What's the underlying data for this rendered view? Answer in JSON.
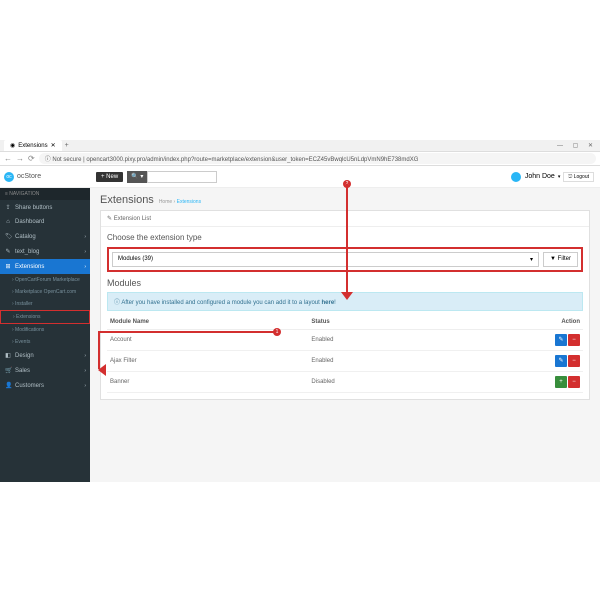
{
  "browser": {
    "tab_title": "Extensions",
    "url": "opencart3000.pixy.pro/admin/index.php?route=marketplace/extension&user_token=ECZ45vBwqlcU5nLdpVmN9hE738mdXG",
    "not_secure": "Not secure"
  },
  "header": {
    "logo": "ocStore",
    "new_btn": "+ New",
    "user_name": "John Doe",
    "logout": "Logout"
  },
  "sidebar": {
    "nav_header": "≡ NAVIGATION",
    "items": [
      {
        "icon": "⇪",
        "label": "Share buttons"
      },
      {
        "icon": "⌂",
        "label": "Dashboard"
      },
      {
        "icon": "🏷",
        "label": "Catalog",
        "chev": "›"
      },
      {
        "icon": "✎",
        "label": "text_blog",
        "chev": "›"
      },
      {
        "icon": "⊞",
        "label": "Extensions",
        "chev": "›",
        "active": true
      }
    ],
    "subs": [
      "OpenCartForum Marketplace",
      "Marketplace OpenCart.com",
      "Installer",
      "Extensions",
      "Modifications",
      "Events"
    ],
    "items2": [
      {
        "icon": "◧",
        "label": "Design",
        "chev": "›"
      },
      {
        "icon": "🛒",
        "label": "Sales",
        "chev": "›"
      },
      {
        "icon": "👤",
        "label": "Customers",
        "chev": "›"
      }
    ]
  },
  "page": {
    "title": "Extensions",
    "bc_home": "Home",
    "bc_ext": "Extensions",
    "panel_hd": "Extension List",
    "choose_label": "Choose the extension type",
    "select_value": "Modules (39)",
    "filter_btn": "▼ Filter",
    "modules_title": "Modules",
    "alert_text": "After you have installed and configured a module you can add it to a layout",
    "alert_link": "here",
    "th_name": "Module Name",
    "th_status": "Status",
    "th_action": "Action",
    "rows": [
      {
        "name": "Account",
        "status": "Enabled",
        "edit": true
      },
      {
        "name": "Ajax Filter",
        "status": "Enabled",
        "edit": true
      },
      {
        "name": "Banner",
        "status": "Disabled",
        "edit": false
      }
    ]
  }
}
